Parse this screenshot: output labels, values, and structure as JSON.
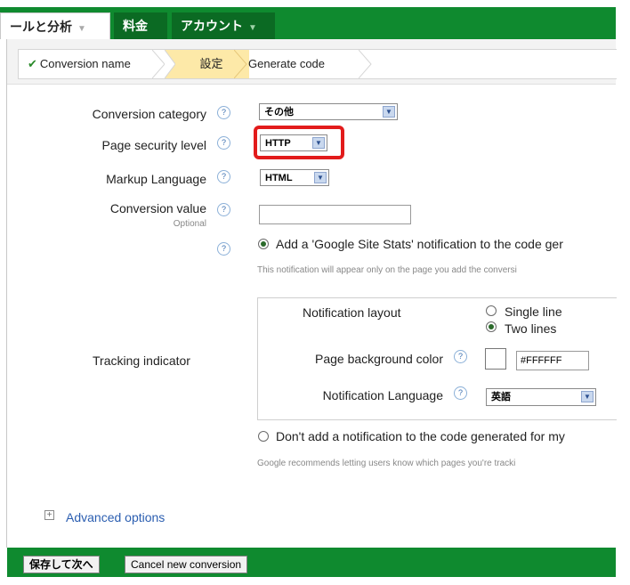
{
  "nav": {
    "tab_tools": "ールと分析",
    "tab_billing": "料金",
    "tab_account": "アカウント",
    "caret": "▼"
  },
  "breadcrumb": {
    "step1": "Conversion name",
    "step2": "設定",
    "step3": "Generate code",
    "check": "✔"
  },
  "form": {
    "conversion_category_label": "Conversion category",
    "conversion_category_value": "その他",
    "page_security_label": "Page security level",
    "page_security_value": "HTTP",
    "markup_language_label": "Markup Language",
    "markup_language_value": "HTML",
    "conversion_value_label": "Conversion value",
    "conversion_value_optional": "Optional",
    "conversion_value_input": "",
    "help_glyph": "?",
    "select_arrow": "▼"
  },
  "tracking": {
    "label": "Tracking indicator",
    "option_add": "Add a 'Google Site Stats' notification to the code ger",
    "option_add_note": "This notification will appear only on the page you add the conversi",
    "notification_layout_label": "Notification layout",
    "layout_single": "Single line",
    "layout_two": "Two lines",
    "bg_color_label": "Page background color",
    "bg_color_value": "#FFFFFF",
    "swatch_color": "#FFFFFF",
    "language_label": "Notification Language",
    "language_value": "英語",
    "option_dont": "Don't add a notification to the code generated for my",
    "option_dont_note": "Google recommends letting users know which pages you're tracki"
  },
  "advanced": {
    "icon": "+",
    "label": "Advanced options"
  },
  "footer": {
    "save_next": "保存して次へ",
    "cancel": "Cancel new conversion"
  },
  "colors": {
    "nav_green": "#0f8a2f",
    "highlight_red": "#e21b1b",
    "current_step": "#fde9a8"
  }
}
